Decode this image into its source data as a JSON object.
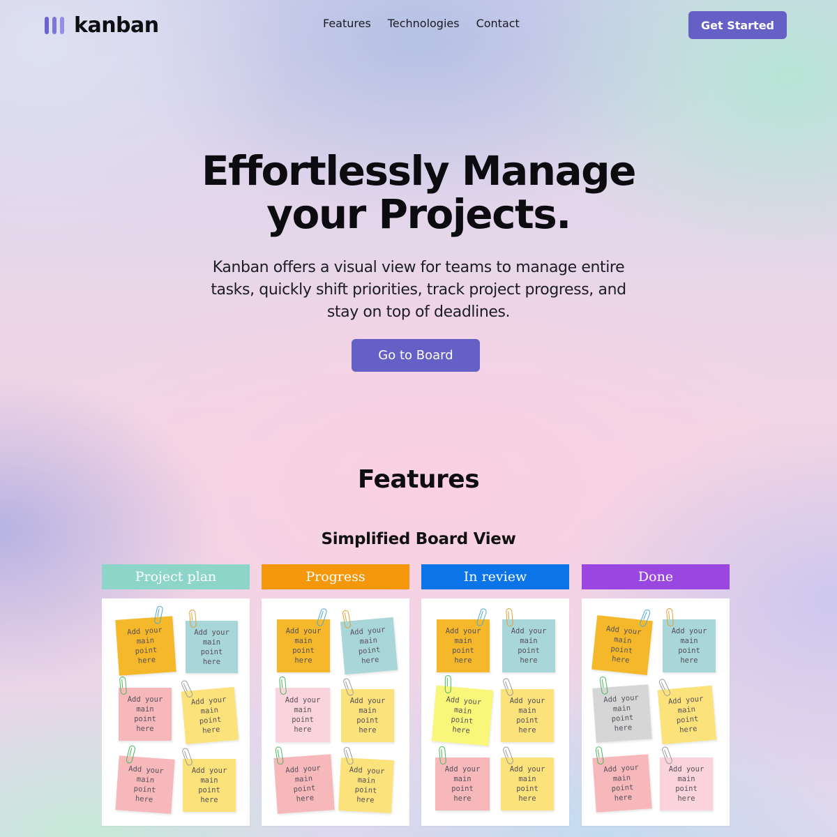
{
  "nav": {
    "logo_text": "kanban",
    "links": [
      "Features",
      "Technologies",
      "Contact"
    ],
    "cta": "Get Started"
  },
  "hero": {
    "title_line1": "Effortlessly Manage",
    "title_line2": "your Projects.",
    "subtitle": "Kanban offers a visual view for teams to manage entire tasks, quickly shift priorities, track project progress, and stay on top of deadlines.",
    "button": "Go to Board"
  },
  "features": {
    "title": "Features",
    "subtitle": "Simplified Board View"
  },
  "colors": {
    "accent": "#6560c6"
  },
  "board": {
    "columns": [
      {
        "label": "Project plan",
        "color": "#8dd5c8",
        "notes": [
          {
            "text": "Add your main point here",
            "color": "#f5b82a",
            "clip": "#4aa8e0"
          },
          {
            "text": "Add your main point here",
            "color": "#a9d6d8",
            "clip": "#e0a030"
          },
          {
            "text": "Add your main point here",
            "color": "#f6b8ba",
            "clip": "#46b85a"
          },
          {
            "text": "Add your main point here",
            "color": "#fce27a",
            "clip": "#9a9aa2"
          },
          {
            "text": "Add your main point here",
            "color": "#f6b8ba",
            "clip": "#46b85a"
          },
          {
            "text": "Add your main point here",
            "color": "#fce27a",
            "clip": "#9a9aa2"
          }
        ]
      },
      {
        "label": "Progress",
        "color": "#f4970b",
        "notes": [
          {
            "text": "Add your main point here",
            "color": "#f5b82a",
            "clip": "#4aa8e0"
          },
          {
            "text": "Add your main point here",
            "color": "#a9d6d8",
            "clip": "#e0a030"
          },
          {
            "text": "Add your main point here",
            "color": "#fbd3dc",
            "clip": "#46b85a"
          },
          {
            "text": "Add your main point here",
            "color": "#fce27a",
            "clip": "#9a9aa2"
          },
          {
            "text": "Add your main point here",
            "color": "#f6b8ba",
            "clip": "#46b85a"
          },
          {
            "text": "Add your main point here",
            "color": "#fce27a",
            "clip": "#9a9aa2"
          }
        ]
      },
      {
        "label": "In review",
        "color": "#0b74e8",
        "notes": [
          {
            "text": "Add your main point here",
            "color": "#f5b82a",
            "clip": "#4aa8e0"
          },
          {
            "text": "Add your main point here",
            "color": "#a9d6d8",
            "clip": "#e0a030"
          },
          {
            "text": "Add your main point here",
            "color": "#f8f77a",
            "clip": "#46b85a"
          },
          {
            "text": "Add your main point here",
            "color": "#fce27a",
            "clip": "#9a9aa2"
          },
          {
            "text": "Add your main point here",
            "color": "#f6b8ba",
            "clip": "#46b85a"
          },
          {
            "text": "Add your main point here",
            "color": "#fce27a",
            "clip": "#9a9aa2"
          }
        ]
      },
      {
        "label": "Done",
        "color": "#9a46e0",
        "notes": [
          {
            "text": "Add your main point here",
            "color": "#f5b82a",
            "clip": "#4aa8e0"
          },
          {
            "text": "Add your main point here",
            "color": "#a9d6d8",
            "clip": "#e0a030"
          },
          {
            "text": "Add your main point here",
            "color": "#d6d6d6",
            "clip": "#46b85a"
          },
          {
            "text": "Add your main point here",
            "color": "#fce27a",
            "clip": "#9a9aa2"
          },
          {
            "text": "Add your main point here",
            "color": "#f6b8ba",
            "clip": "#46b85a"
          },
          {
            "text": "Add your main point here",
            "color": "#fbd3dc",
            "clip": "#9a9aa2"
          }
        ]
      }
    ]
  }
}
